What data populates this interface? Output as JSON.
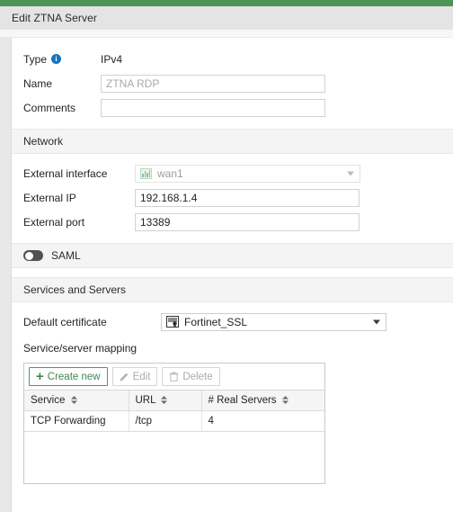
{
  "window": {
    "title": "Edit ZTNA Server",
    "accent_color": "#4f9358"
  },
  "form": {
    "type": {
      "label": "Type",
      "info_icon": "info-icon",
      "value": "IPv4"
    },
    "name": {
      "label": "Name",
      "value": "",
      "placeholder": "ZTNA RDP"
    },
    "comments": {
      "label": "Comments",
      "value": "",
      "placeholder": ""
    }
  },
  "network": {
    "section_title": "Network",
    "external_interface": {
      "label": "External interface",
      "value": "wan1",
      "icon": "network-port-icon",
      "disabled": true
    },
    "external_ip": {
      "label": "External IP",
      "value": "192.168.1.4"
    },
    "external_port": {
      "label": "External port",
      "value": "13389"
    }
  },
  "saml": {
    "label": "SAML",
    "enabled": false
  },
  "services": {
    "section_title": "Services and Servers",
    "default_certificate": {
      "label": "Default certificate",
      "value": "Fortinet_SSL",
      "icon": "certificate-icon"
    },
    "mapping_label": "Service/server mapping",
    "toolbar": {
      "create_new": "Create new",
      "edit": "Edit",
      "delete": "Delete"
    },
    "table": {
      "columns": [
        "Service",
        "URL",
        "# Real Servers"
      ],
      "rows": [
        {
          "service": "TCP Forwarding",
          "url": "/tcp",
          "real_servers": "4"
        }
      ]
    }
  }
}
